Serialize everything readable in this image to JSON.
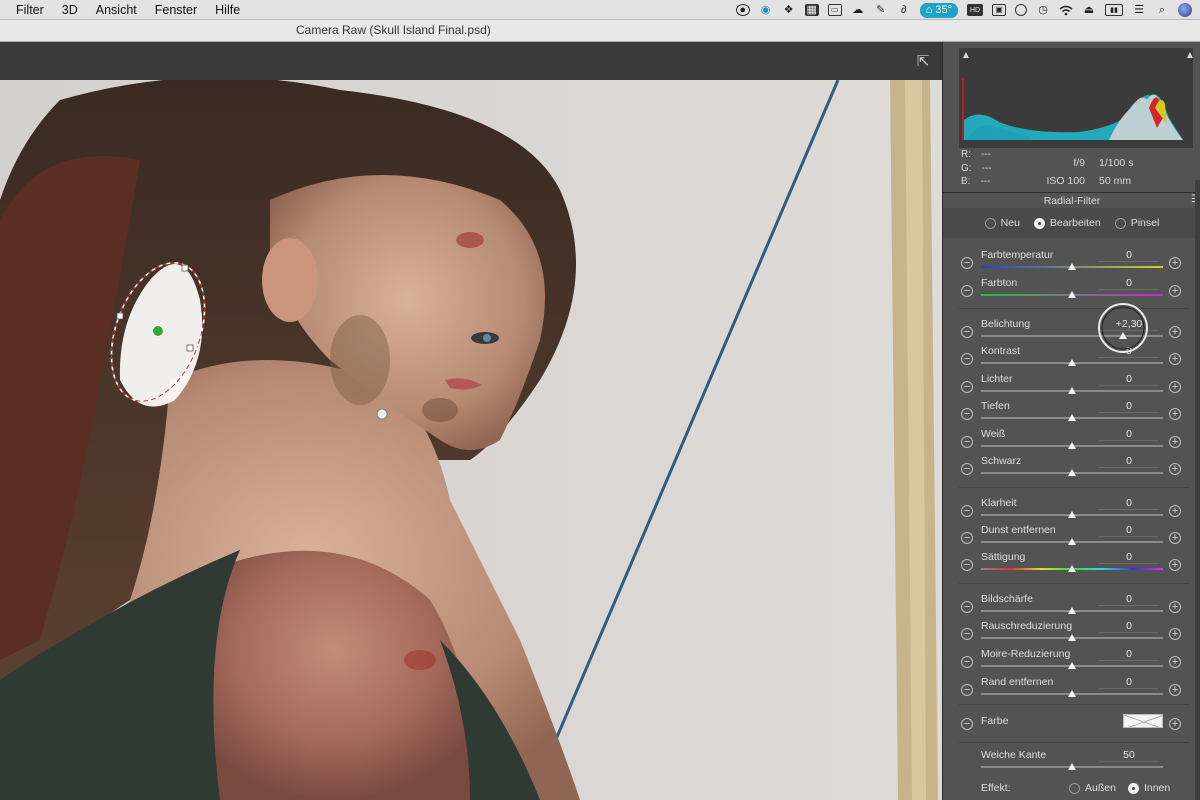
{
  "menubar": {
    "items": [
      "Filter",
      "3D",
      "Ansicht",
      "Fenster",
      "Hilfe"
    ],
    "status": {
      "temperature": "35°",
      "icons": [
        "record-icon",
        "globe-icon",
        "dropbox-icon",
        "calendar-icon",
        "cast-icon",
        "cloud-icon",
        "evernote-icon",
        "signature-icon",
        "temperature-badge",
        "hd-icon",
        "window-icon",
        "circle-icon",
        "time-machine-icon",
        "wifi-icon",
        "airplay-icon",
        "battery-icon",
        "display-icon",
        "search-icon",
        "user-avatar"
      ]
    }
  },
  "window": {
    "title": "Camera Raw (Skull Island Final.psd)"
  },
  "histogram": {
    "r_label": "R:",
    "g_label": "G:",
    "b_label": "B:",
    "r_value": "---",
    "g_value": "---",
    "b_value": "---",
    "aperture": "f/9",
    "shutter": "1/100 s",
    "iso": "ISO 100",
    "focal": "50 mm"
  },
  "panel": {
    "title": "Radial-Filter",
    "modes": [
      "Neu",
      "Bearbeiten",
      "Pinsel"
    ],
    "selected_mode": "Bearbeiten"
  },
  "sliders": [
    {
      "label": "Farbtemperatur",
      "value": "0",
      "position": 0.5
    },
    {
      "label": "Farbton",
      "value": "0",
      "position": 0.5
    },
    {
      "label": "Belichtung",
      "value": "+2,30",
      "position": 0.78
    },
    {
      "label": "Kontrast",
      "value": "0",
      "position": 0.5
    },
    {
      "label": "Lichter",
      "value": "0",
      "position": 0.5
    },
    {
      "label": "Tiefen",
      "value": "0",
      "position": 0.5
    },
    {
      "label": "Weiß",
      "value": "0",
      "position": 0.5
    },
    {
      "label": "Schwarz",
      "value": "0",
      "position": 0.5
    },
    {
      "label": "Klarheit",
      "value": "0",
      "position": 0.5
    },
    {
      "label": "Dunst entfernen",
      "value": "0",
      "position": 0.5
    },
    {
      "label": "Sättigung",
      "value": "0",
      "position": 0.5
    },
    {
      "label": "Bildschärfe",
      "value": "0",
      "position": 0.5
    },
    {
      "label": "Rauschreduzierung",
      "value": "0",
      "position": 0.5
    },
    {
      "label": "Moire-Reduzierung",
      "value": "0",
      "position": 0.5
    },
    {
      "label": "Rand entfernen",
      "value": "0",
      "position": 0.5
    }
  ],
  "farbe": {
    "label": "Farbe"
  },
  "feather": {
    "label": "Weiche Kante",
    "value": "50",
    "position": 0.5
  },
  "effect": {
    "label": "Effekt:",
    "options": [
      "Außen",
      "Innen"
    ],
    "selected": "Innen"
  },
  "colors": {
    "panel_bg": "#535353",
    "accent_badge": "#1fa3c9",
    "pin_green": "#2faa3a"
  }
}
